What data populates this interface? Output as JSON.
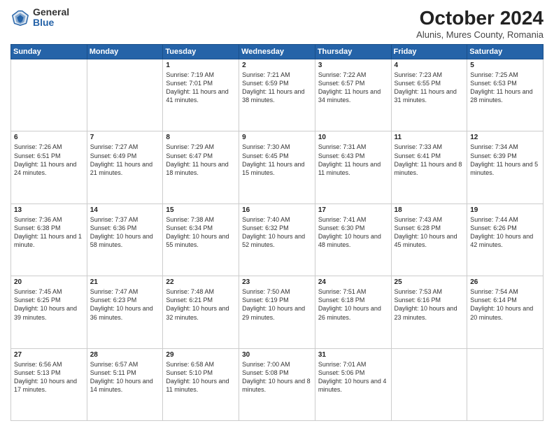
{
  "header": {
    "logo_general": "General",
    "logo_blue": "Blue",
    "month_title": "October 2024",
    "location": "Alunis, Mures County, Romania"
  },
  "days_of_week": [
    "Sunday",
    "Monday",
    "Tuesday",
    "Wednesday",
    "Thursday",
    "Friday",
    "Saturday"
  ],
  "weeks": [
    [
      {
        "day": "",
        "detail": ""
      },
      {
        "day": "",
        "detail": ""
      },
      {
        "day": "1",
        "detail": "Sunrise: 7:19 AM\nSunset: 7:01 PM\nDaylight: 11 hours and 41 minutes."
      },
      {
        "day": "2",
        "detail": "Sunrise: 7:21 AM\nSunset: 6:59 PM\nDaylight: 11 hours and 38 minutes."
      },
      {
        "day": "3",
        "detail": "Sunrise: 7:22 AM\nSunset: 6:57 PM\nDaylight: 11 hours and 34 minutes."
      },
      {
        "day": "4",
        "detail": "Sunrise: 7:23 AM\nSunset: 6:55 PM\nDaylight: 11 hours and 31 minutes."
      },
      {
        "day": "5",
        "detail": "Sunrise: 7:25 AM\nSunset: 6:53 PM\nDaylight: 11 hours and 28 minutes."
      }
    ],
    [
      {
        "day": "6",
        "detail": "Sunrise: 7:26 AM\nSunset: 6:51 PM\nDaylight: 11 hours and 24 minutes."
      },
      {
        "day": "7",
        "detail": "Sunrise: 7:27 AM\nSunset: 6:49 PM\nDaylight: 11 hours and 21 minutes."
      },
      {
        "day": "8",
        "detail": "Sunrise: 7:29 AM\nSunset: 6:47 PM\nDaylight: 11 hours and 18 minutes."
      },
      {
        "day": "9",
        "detail": "Sunrise: 7:30 AM\nSunset: 6:45 PM\nDaylight: 11 hours and 15 minutes."
      },
      {
        "day": "10",
        "detail": "Sunrise: 7:31 AM\nSunset: 6:43 PM\nDaylight: 11 hours and 11 minutes."
      },
      {
        "day": "11",
        "detail": "Sunrise: 7:33 AM\nSunset: 6:41 PM\nDaylight: 11 hours and 8 minutes."
      },
      {
        "day": "12",
        "detail": "Sunrise: 7:34 AM\nSunset: 6:39 PM\nDaylight: 11 hours and 5 minutes."
      }
    ],
    [
      {
        "day": "13",
        "detail": "Sunrise: 7:36 AM\nSunset: 6:38 PM\nDaylight: 11 hours and 1 minute."
      },
      {
        "day": "14",
        "detail": "Sunrise: 7:37 AM\nSunset: 6:36 PM\nDaylight: 10 hours and 58 minutes."
      },
      {
        "day": "15",
        "detail": "Sunrise: 7:38 AM\nSunset: 6:34 PM\nDaylight: 10 hours and 55 minutes."
      },
      {
        "day": "16",
        "detail": "Sunrise: 7:40 AM\nSunset: 6:32 PM\nDaylight: 10 hours and 52 minutes."
      },
      {
        "day": "17",
        "detail": "Sunrise: 7:41 AM\nSunset: 6:30 PM\nDaylight: 10 hours and 48 minutes."
      },
      {
        "day": "18",
        "detail": "Sunrise: 7:43 AM\nSunset: 6:28 PM\nDaylight: 10 hours and 45 minutes."
      },
      {
        "day": "19",
        "detail": "Sunrise: 7:44 AM\nSunset: 6:26 PM\nDaylight: 10 hours and 42 minutes."
      }
    ],
    [
      {
        "day": "20",
        "detail": "Sunrise: 7:45 AM\nSunset: 6:25 PM\nDaylight: 10 hours and 39 minutes."
      },
      {
        "day": "21",
        "detail": "Sunrise: 7:47 AM\nSunset: 6:23 PM\nDaylight: 10 hours and 36 minutes."
      },
      {
        "day": "22",
        "detail": "Sunrise: 7:48 AM\nSunset: 6:21 PM\nDaylight: 10 hours and 32 minutes."
      },
      {
        "day": "23",
        "detail": "Sunrise: 7:50 AM\nSunset: 6:19 PM\nDaylight: 10 hours and 29 minutes."
      },
      {
        "day": "24",
        "detail": "Sunrise: 7:51 AM\nSunset: 6:18 PM\nDaylight: 10 hours and 26 minutes."
      },
      {
        "day": "25",
        "detail": "Sunrise: 7:53 AM\nSunset: 6:16 PM\nDaylight: 10 hours and 23 minutes."
      },
      {
        "day": "26",
        "detail": "Sunrise: 7:54 AM\nSunset: 6:14 PM\nDaylight: 10 hours and 20 minutes."
      }
    ],
    [
      {
        "day": "27",
        "detail": "Sunrise: 6:56 AM\nSunset: 5:13 PM\nDaylight: 10 hours and 17 minutes."
      },
      {
        "day": "28",
        "detail": "Sunrise: 6:57 AM\nSunset: 5:11 PM\nDaylight: 10 hours and 14 minutes."
      },
      {
        "day": "29",
        "detail": "Sunrise: 6:58 AM\nSunset: 5:10 PM\nDaylight: 10 hours and 11 minutes."
      },
      {
        "day": "30",
        "detail": "Sunrise: 7:00 AM\nSunset: 5:08 PM\nDaylight: 10 hours and 8 minutes."
      },
      {
        "day": "31",
        "detail": "Sunrise: 7:01 AM\nSunset: 5:06 PM\nDaylight: 10 hours and 4 minutes."
      },
      {
        "day": "",
        "detail": ""
      },
      {
        "day": "",
        "detail": ""
      }
    ]
  ]
}
